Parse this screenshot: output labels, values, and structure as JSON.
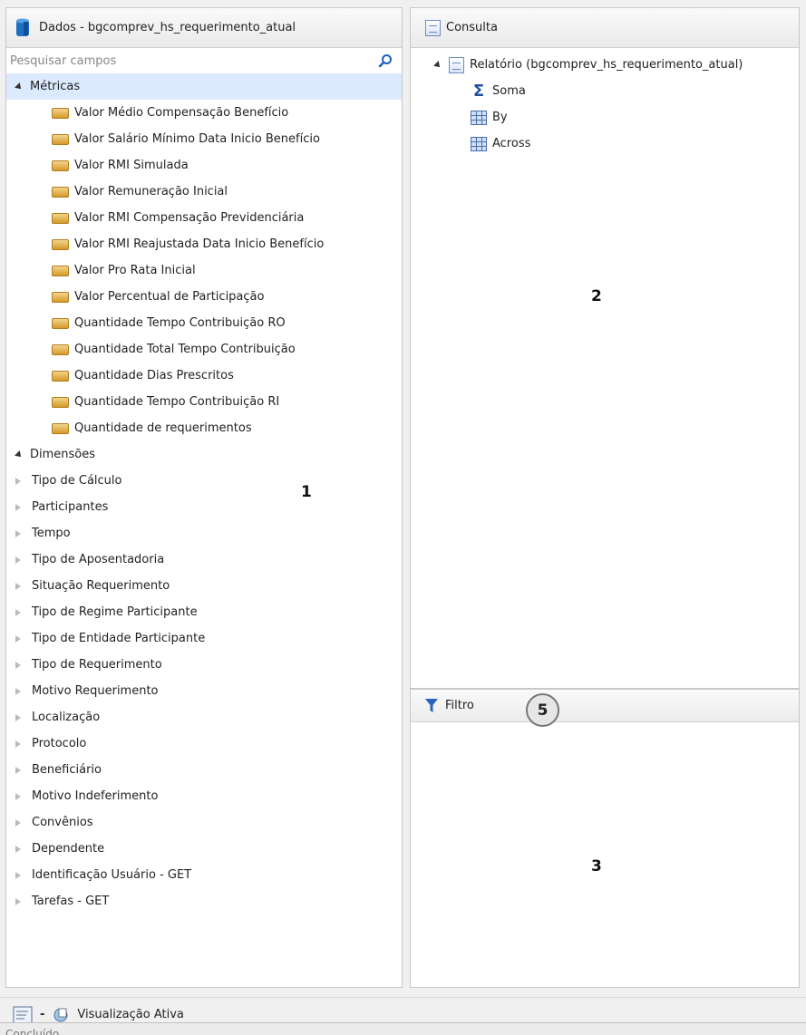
{
  "left_panel": {
    "title": "Dados - bgcomprev_hs_requerimento_atual",
    "search_placeholder": "Pesquisar campos",
    "metrics_label": "Métricas",
    "metrics": [
      "Valor Médio Compensação Benefício",
      "Valor Salário Mínimo Data Inicio Benefício",
      "Valor RMI Simulada",
      "Valor Remuneração Inicial",
      "Valor RMI Compensação Previdenciária",
      "Valor RMI Reajustada Data Inicio Benefício",
      "Valor Pro Rata Inicial",
      "Valor Percentual de Participação",
      "Quantidade Tempo Contribuição RO",
      "Quantidade Total Tempo Contribuição",
      "Quantidade Dias Prescritos",
      "Quantidade Tempo Contribuição RI",
      "Quantidade de requerimentos"
    ],
    "dimensions_label": "Dimensões",
    "dimensions": [
      "Tipo de Cálculo",
      "Participantes",
      "Tempo",
      "Tipo de Aposentadoria",
      "Situação Requerimento",
      "Tipo de Regime Participante",
      "Tipo de Entidade Participante",
      "Tipo de Requerimento",
      "Motivo Requerimento",
      "Localização",
      "Protocolo",
      "Beneficiário",
      "Motivo Indeferimento",
      "Convênios",
      "Dependente",
      "Identificação Usuário - GET",
      "Tarefas - GET"
    ],
    "marker": "1"
  },
  "query_panel": {
    "title": "Consulta",
    "report_label": "Relatório (bgcomprev_hs_requerimento_atual)",
    "children": [
      {
        "label": "Soma",
        "icon": "sigma-icon"
      },
      {
        "label": "By",
        "icon": "grid-icon"
      },
      {
        "label": "Across",
        "icon": "grid-icon"
      }
    ],
    "marker": "2"
  },
  "filter_panel": {
    "title": "Filtro",
    "marker": "3",
    "callout": "5"
  },
  "toolbar": {
    "dash": "-",
    "active_view_label": "Visualização Ativa"
  },
  "status": {
    "text": "Concluído"
  }
}
